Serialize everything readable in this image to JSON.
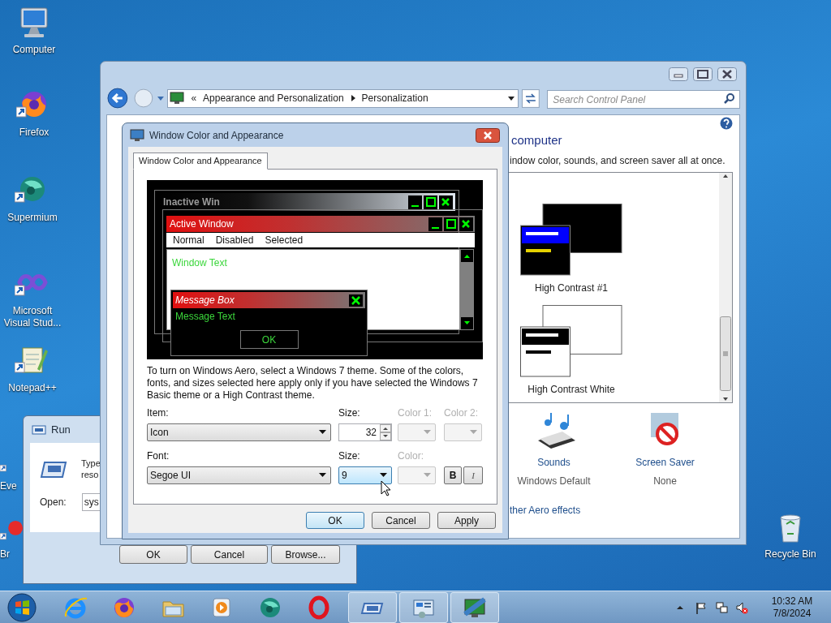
{
  "desktop_icons": [
    {
      "kind": "computer",
      "label": "Computer"
    },
    {
      "kind": "firefox",
      "label": "Firefox"
    },
    {
      "kind": "supermium",
      "label": "Supermium"
    },
    {
      "kind": "visualstudio",
      "label": "Microsoft Visual Stud..."
    },
    {
      "kind": "notepad",
      "label": "Notepad++"
    },
    {
      "kind": "partial-green",
      "label": "Eve"
    },
    {
      "kind": "partial-red",
      "label": "Br"
    },
    {
      "kind": "recycle",
      "label": "Recycle Bin"
    }
  ],
  "run_window": {
    "title": "Run",
    "description_lines": [
      "Type",
      "reso"
    ],
    "open_label": "Open:",
    "open_value": "sys",
    "buttons": [
      "OK",
      "Cancel",
      "Browse..."
    ]
  },
  "control_panel": {
    "address_chevron": "«",
    "breadcrumbs": [
      "Appearance and Personalization",
      "Personalization"
    ],
    "search": {
      "placeholder": "Search Control Panel"
    },
    "heading": "computer",
    "subtitle": "indow color, sounds, and screen saver all at once.",
    "themes": [
      {
        "kind": "high-contrast-black",
        "name": "High Contrast #1"
      },
      {
        "kind": "high-contrast-white",
        "name": "High Contrast White"
      }
    ],
    "settings": [
      {
        "kind": "sounds",
        "label": "Sounds",
        "value": "Windows Default"
      },
      {
        "kind": "screensaver",
        "label": "Screen Saver",
        "value": "None"
      }
    ],
    "link": "ther Aero effects"
  },
  "dialog": {
    "title": "Window Color and Appearance",
    "tabs": [
      {
        "label": "Window Color and Appearance",
        "selected": true
      }
    ],
    "preview": {
      "inactive_title": "Inactive Win",
      "active_title": "Active Window",
      "menu": [
        "Normal",
        "Disabled",
        "Selected"
      ],
      "window_text": "Window Text",
      "message_title": "Message Box",
      "message_text": "Message Text",
      "message_button": "OK"
    },
    "description": "To turn on Windows Aero, select a Windows 7 theme.  Some of the colors, fonts, and sizes selected here apply only if you have selected the Windows 7 Basic theme or a High Contrast theme.",
    "item": {
      "label": "Item:",
      "value": "Icon"
    },
    "item_size": {
      "label": "Size:",
      "value": "32"
    },
    "color1": {
      "label": "Color 1:",
      "disabled": true
    },
    "color2": {
      "label": "Color 2:",
      "disabled": true
    },
    "font": {
      "label": "Font:",
      "value": "Segoe UI"
    },
    "font_size": {
      "label": "Size:",
      "value": "9",
      "focused": true
    },
    "font_color": {
      "label": "Color:",
      "disabled": true
    },
    "bold": {
      "label": "B"
    },
    "italic": {
      "label": "I"
    },
    "buttons": [
      {
        "label": "OK",
        "default": true
      },
      {
        "label": "Cancel",
        "default": false
      },
      {
        "label": "Apply",
        "default": false
      }
    ]
  },
  "taskbar": {
    "pinned": [
      {
        "kind": "internet-explorer"
      },
      {
        "kind": "firefox"
      },
      {
        "kind": "folder"
      },
      {
        "kind": "media-player"
      },
      {
        "kind": "supermium"
      },
      {
        "kind": "opera"
      }
    ],
    "tasks": [
      {
        "kind": "run"
      },
      {
        "kind": "control-panel"
      },
      {
        "kind": "display"
      }
    ],
    "tray": [
      {
        "kind": "chevron"
      },
      {
        "kind": "flag"
      },
      {
        "kind": "network"
      },
      {
        "kind": "speaker-muted"
      }
    ],
    "time": "10:32 AM",
    "date": "7/8/2024"
  }
}
